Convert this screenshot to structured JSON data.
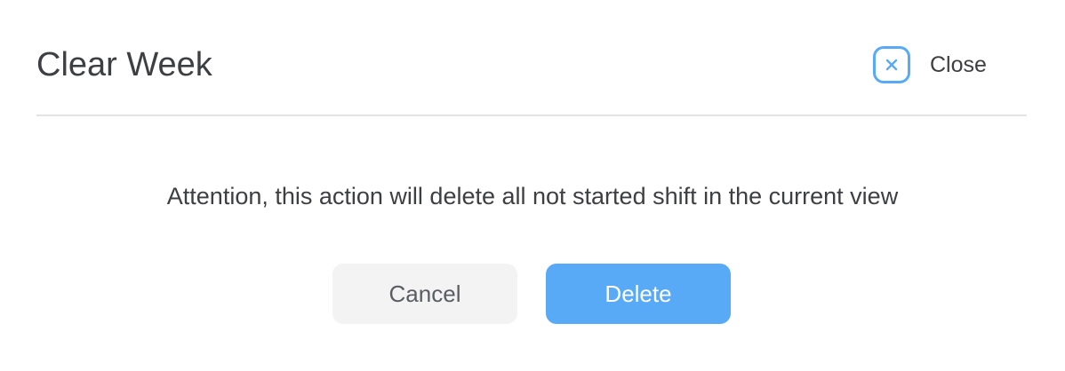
{
  "dialog": {
    "title": "Clear Week",
    "close_label": "Close",
    "message": "Attention, this action will delete all not started shift in the current view",
    "cancel_label": "Cancel",
    "delete_label": "Delete"
  },
  "colors": {
    "accent": "#58aaf6",
    "text": "#3d3f43",
    "cancel_bg": "#f3f3f3",
    "divider": "#e3e3e3"
  },
  "icons": {
    "close": "close-icon"
  }
}
